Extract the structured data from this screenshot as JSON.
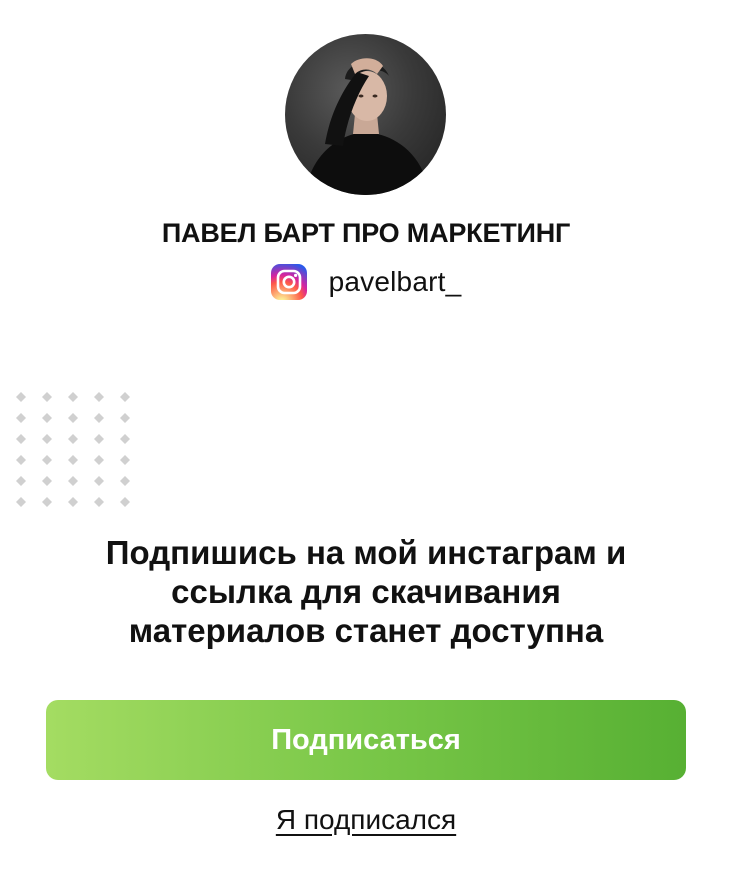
{
  "profile": {
    "name": "ПАВЕЛ БАРТ ПРО МАРКЕТИНГ",
    "handle": "pavelbart_",
    "handle_icon": "instagram-icon"
  },
  "main": {
    "headline_lines": [
      "Подпишись на мой инстаграм и",
      "ссылка для скачивания",
      "материалов станет доступна"
    ],
    "subscribe_button_label": "Подписаться",
    "subscribed_link_label": "Я подписался"
  },
  "colors": {
    "button_gradient_start": "#a4dc62",
    "button_gradient_end": "#57b033",
    "text": "#111111",
    "decor_dots": "#d0d0d0"
  }
}
